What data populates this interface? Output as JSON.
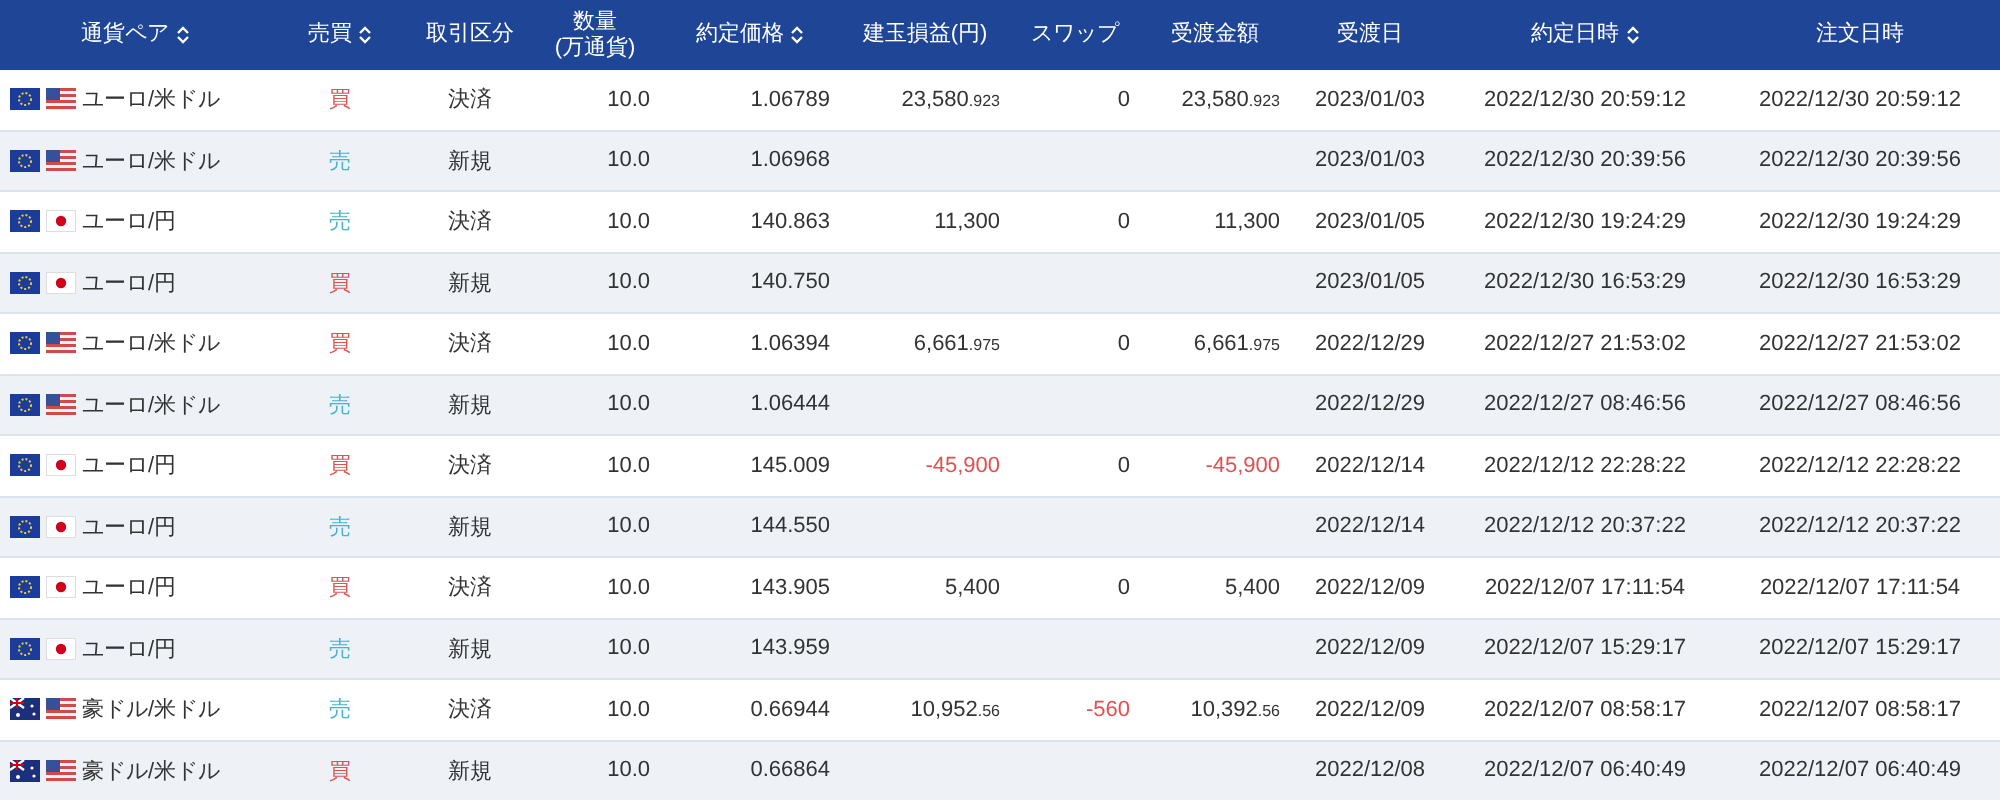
{
  "columns": [
    {
      "label": "通貨ペア",
      "sortable": true
    },
    {
      "label": "売買",
      "sortable": true
    },
    {
      "label": "取引区分",
      "sortable": false
    },
    {
      "label": "数量",
      "sub": "(万通貨)",
      "sortable": false
    },
    {
      "label": "約定価格",
      "sortable": true
    },
    {
      "label": "建玉損益(円)",
      "sortable": false
    },
    {
      "label": "スワップ",
      "sortable": false
    },
    {
      "label": "受渡金額",
      "sortable": false
    },
    {
      "label": "受渡日",
      "sortable": false
    },
    {
      "label": "約定日時",
      "sortable": true
    },
    {
      "label": "注文日時",
      "sortable": false
    }
  ],
  "rows": [
    {
      "flags": [
        {
          "kind": "eu"
        },
        {
          "kind": "us"
        }
      ],
      "pair": "ユーロ/米ドル",
      "side": {
        "text": "買",
        "kind": "buy"
      },
      "type": "決済",
      "qty": "10.0",
      "price": "1.06789",
      "pl": {
        "main": "23,580",
        "fraction": ".923",
        "negative": false
      },
      "swap": {
        "text": "0",
        "negative": false
      },
      "amount": {
        "main": "23,580",
        "fraction": ".923",
        "negative": false
      },
      "delivery": "2023/01/03",
      "executed": "2022/12/30 20:59:12",
      "ordered": "2022/12/30 20:59:12"
    },
    {
      "flags": [
        {
          "kind": "eu"
        },
        {
          "kind": "us"
        }
      ],
      "pair": "ユーロ/米ドル",
      "side": {
        "text": "売",
        "kind": "sell"
      },
      "type": "新規",
      "qty": "10.0",
      "price": "1.06968",
      "delivery": "2023/01/03",
      "executed": "2022/12/30 20:39:56",
      "ordered": "2022/12/30 20:39:56"
    },
    {
      "flags": [
        {
          "kind": "eu"
        },
        {
          "kind": "jp"
        }
      ],
      "pair": "ユーロ/円",
      "side": {
        "text": "売",
        "kind": "sell"
      },
      "type": "決済",
      "qty": "10.0",
      "price": "140.863",
      "pl": {
        "main": "11,300",
        "negative": false
      },
      "swap": {
        "text": "0",
        "negative": false
      },
      "amount": {
        "main": "11,300",
        "negative": false
      },
      "delivery": "2023/01/05",
      "executed": "2022/12/30 19:24:29",
      "ordered": "2022/12/30 19:24:29"
    },
    {
      "flags": [
        {
          "kind": "eu"
        },
        {
          "kind": "jp"
        }
      ],
      "pair": "ユーロ/円",
      "side": {
        "text": "買",
        "kind": "buy"
      },
      "type": "新規",
      "qty": "10.0",
      "price": "140.750",
      "delivery": "2023/01/05",
      "executed": "2022/12/30 16:53:29",
      "ordered": "2022/12/30 16:53:29"
    },
    {
      "flags": [
        {
          "kind": "eu"
        },
        {
          "kind": "us"
        }
      ],
      "pair": "ユーロ/米ドル",
      "side": {
        "text": "買",
        "kind": "buy"
      },
      "type": "決済",
      "qty": "10.0",
      "price": "1.06394",
      "pl": {
        "main": "6,661",
        "fraction": ".975",
        "negative": false
      },
      "swap": {
        "text": "0",
        "negative": false
      },
      "amount": {
        "main": "6,661",
        "fraction": ".975",
        "negative": false
      },
      "delivery": "2022/12/29",
      "executed": "2022/12/27 21:53:02",
      "ordered": "2022/12/27 21:53:02"
    },
    {
      "flags": [
        {
          "kind": "eu"
        },
        {
          "kind": "us"
        }
      ],
      "pair": "ユーロ/米ドル",
      "side": {
        "text": "売",
        "kind": "sell"
      },
      "type": "新規",
      "qty": "10.0",
      "price": "1.06444",
      "delivery": "2022/12/29",
      "executed": "2022/12/27 08:46:56",
      "ordered": "2022/12/27 08:46:56"
    },
    {
      "flags": [
        {
          "kind": "eu"
        },
        {
          "kind": "jp"
        }
      ],
      "pair": "ユーロ/円",
      "side": {
        "text": "買",
        "kind": "buy"
      },
      "type": "決済",
      "qty": "10.0",
      "price": "145.009",
      "pl": {
        "main": "-45,900",
        "negative": true
      },
      "swap": {
        "text": "0",
        "negative": false
      },
      "amount": {
        "main": "-45,900",
        "negative": true
      },
      "delivery": "2022/12/14",
      "executed": "2022/12/12 22:28:22",
      "ordered": "2022/12/12 22:28:22"
    },
    {
      "flags": [
        {
          "kind": "eu"
        },
        {
          "kind": "jp"
        }
      ],
      "pair": "ユーロ/円",
      "side": {
        "text": "売",
        "kind": "sell"
      },
      "type": "新規",
      "qty": "10.0",
      "price": "144.550",
      "delivery": "2022/12/14",
      "executed": "2022/12/12 20:37:22",
      "ordered": "2022/12/12 20:37:22"
    },
    {
      "flags": [
        {
          "kind": "eu"
        },
        {
          "kind": "jp"
        }
      ],
      "pair": "ユーロ/円",
      "side": {
        "text": "買",
        "kind": "buy"
      },
      "type": "決済",
      "qty": "10.0",
      "price": "143.905",
      "pl": {
        "main": "5,400",
        "negative": false
      },
      "swap": {
        "text": "0",
        "negative": false
      },
      "amount": {
        "main": "5,400",
        "negative": false
      },
      "delivery": "2022/12/09",
      "executed": "2022/12/07 17:11:54",
      "ordered": "2022/12/07 17:11:54"
    },
    {
      "flags": [
        {
          "kind": "eu"
        },
        {
          "kind": "jp"
        }
      ],
      "pair": "ユーロ/円",
      "side": {
        "text": "売",
        "kind": "sell"
      },
      "type": "新規",
      "qty": "10.0",
      "price": "143.959",
      "delivery": "2022/12/09",
      "executed": "2022/12/07 15:29:17",
      "ordered": "2022/12/07 15:29:17"
    },
    {
      "flags": [
        {
          "kind": "au"
        },
        {
          "kind": "us"
        }
      ],
      "pair": "豪ドル/米ドル",
      "side": {
        "text": "売",
        "kind": "sell"
      },
      "type": "決済",
      "qty": "10.0",
      "price": "0.66944",
      "pl": {
        "main": "10,952",
        "fraction": ".56",
        "negative": false
      },
      "swap": {
        "text": "-560",
        "negative": true
      },
      "amount": {
        "main": "10,392",
        "fraction": ".56",
        "negative": false
      },
      "delivery": "2022/12/09",
      "executed": "2022/12/07 08:58:17",
      "ordered": "2022/12/07 08:58:17"
    },
    {
      "flags": [
        {
          "kind": "au"
        },
        {
          "kind": "us"
        }
      ],
      "pair": "豪ドル/米ドル",
      "side": {
        "text": "買",
        "kind": "buy"
      },
      "type": "新規",
      "qty": "10.0",
      "price": "0.66864",
      "delivery": "2022/12/08",
      "executed": "2022/12/07 06:40:49",
      "ordered": "2022/12/07 06:40:49"
    }
  ]
}
